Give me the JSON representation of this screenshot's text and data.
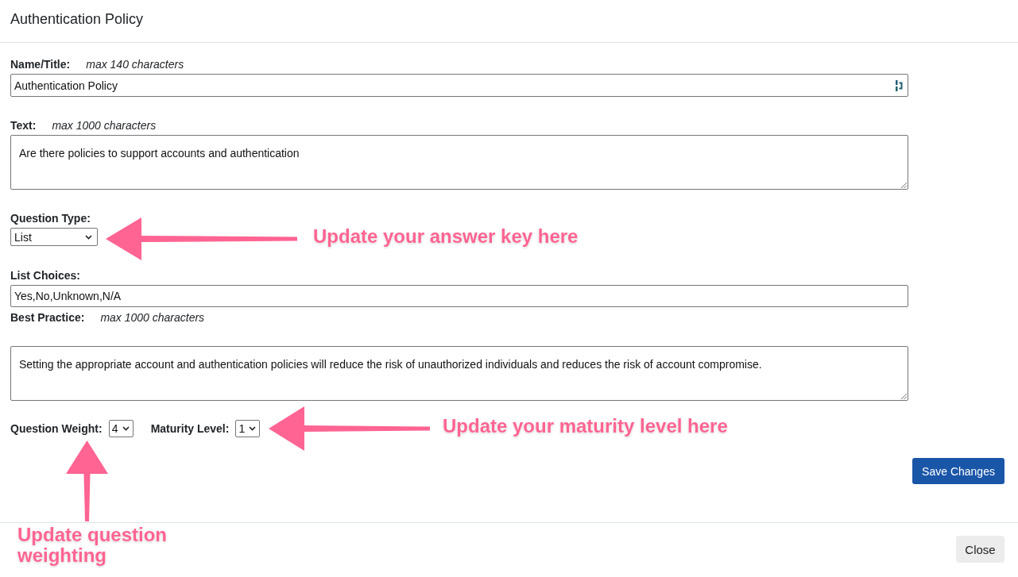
{
  "dialog": {
    "title": "Authentication Policy"
  },
  "form": {
    "name_title": {
      "label": "Name/Title:",
      "hint": "max 140 characters",
      "value": "Authentication Policy"
    },
    "text": {
      "label": "Text:",
      "hint": "max 1000 characters",
      "value": "Are there policies to support accounts and authentication"
    },
    "question_type": {
      "label": "Question Type:",
      "value": "List"
    },
    "list_choices": {
      "label": "List Choices:",
      "value": "Yes,No,Unknown,N/A"
    },
    "best_practice": {
      "label": "Best Practice:",
      "hint": "max 1000 characters",
      "value": "Setting the appropriate account and authentication policies will reduce the risk of unauthorized individuals and reduces the risk of account compromise."
    },
    "question_weight": {
      "label": "Question Weight:",
      "value": "4"
    },
    "maturity_level": {
      "label": "Maturity Level:",
      "value": "1"
    },
    "save_button": "Save Changes"
  },
  "footer": {
    "close_button": "Close"
  },
  "annotations": [
    {
      "kind": "arrow-left",
      "text": "Update your answer key here"
    },
    {
      "kind": "arrow-left",
      "text": "Update your maturity level here"
    },
    {
      "kind": "arrow-up",
      "text": "Update question weighting"
    }
  ]
}
